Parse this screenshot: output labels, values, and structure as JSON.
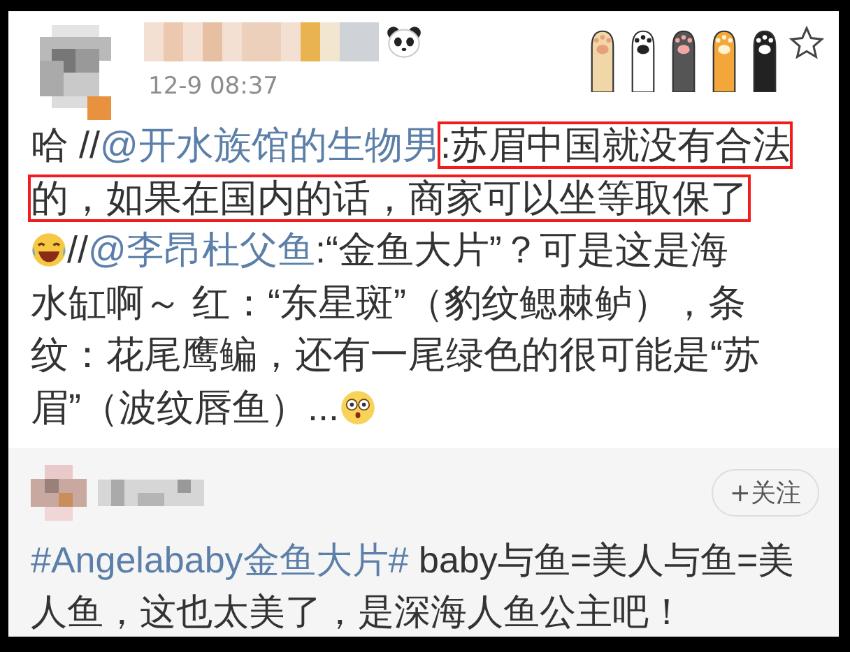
{
  "post": {
    "time": "12-9 08:37",
    "lines": [
      [
        {
          "kind": "text",
          "text": "哈 //"
        },
        {
          "kind": "mention",
          "text": "@开水族馆的生物男"
        },
        {
          "kind": "highlight",
          "text": ":苏眉中国就没有合法"
        }
      ],
      [
        {
          "kind": "highlight",
          "text": "的，如果在国内的话，商家可以坐等取保了"
        }
      ],
      [
        {
          "kind": "emoji"
        },
        {
          "kind": "text",
          "text": "//"
        },
        {
          "kind": "mention",
          "text": "@李昂杜父鱼"
        },
        {
          "kind": "text",
          "text": ":“金鱼大片”？可是这是海"
        }
      ],
      [
        {
          "kind": "text",
          "text": "水缸啊～ 红：“东星斑”（豹纹鳃棘鲈），条"
        }
      ],
      [
        {
          "kind": "text",
          "text": "纹：花尾鹰鳊，还有一尾绿色的很可能是“苏"
        }
      ],
      [
        {
          "kind": "text",
          "text": "眉”（波纹唇鱼）..."
        },
        {
          "kind": "emoji"
        }
      ]
    ]
  },
  "repost": {
    "follow_button": "+关注",
    "lines": [
      [
        {
          "kind": "hashtag",
          "text": "#Angelababy金鱼大片#"
        },
        {
          "kind": "text",
          "text": " baby与鱼=美人与鱼=美"
        }
      ],
      [
        {
          "kind": "text",
          "text": "人鱼，这也太美了，是深海人鱼公主吧！"
        }
      ]
    ]
  }
}
